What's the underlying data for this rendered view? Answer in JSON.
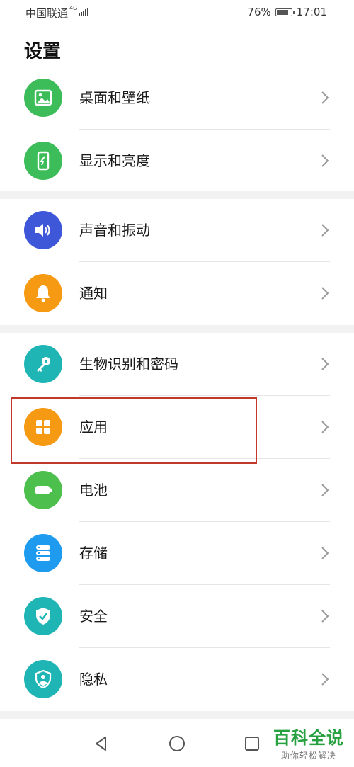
{
  "status": {
    "carrier": "中国联通",
    "network": "4G",
    "battery_text": "76%",
    "battery_level": 0.76,
    "time": "17:01"
  },
  "page_title": "设置",
  "groups": [
    {
      "items": [
        {
          "label": "桌面和壁纸",
          "icon": "wallpaper-icon",
          "color": "#3dbc5a"
        },
        {
          "label": "显示和亮度",
          "icon": "display-icon",
          "color": "#3dbc5a"
        }
      ]
    },
    {
      "items": [
        {
          "label": "声音和振动",
          "icon": "sound-icon",
          "color": "#3e57d9"
        },
        {
          "label": "通知",
          "icon": "bell-icon",
          "color": "#f59a12"
        }
      ]
    },
    {
      "items": [
        {
          "label": "生物识别和密码",
          "icon": "key-icon",
          "color": "#1fb5b5"
        },
        {
          "label": "应用",
          "icon": "apps-grid-icon",
          "color": "#f59a12"
        },
        {
          "label": "电池",
          "icon": "battery-icon",
          "color": "#4cbf4c"
        },
        {
          "label": "存储",
          "icon": "storage-icon",
          "color": "#1e9bef"
        },
        {
          "label": "安全",
          "icon": "shield-check-icon",
          "color": "#1fb5b5"
        },
        {
          "label": "隐私",
          "icon": "privacy-shield-icon",
          "color": "#1fb5b5"
        }
      ]
    }
  ],
  "highlighted_item": "应用",
  "highlight_color": "#c0392b",
  "navbar": {
    "back": "back-icon",
    "home": "home-icon",
    "recent": "recent-apps-icon"
  },
  "watermark": {
    "title": "百科全说",
    "subtitle": "助你轻松解决"
  }
}
